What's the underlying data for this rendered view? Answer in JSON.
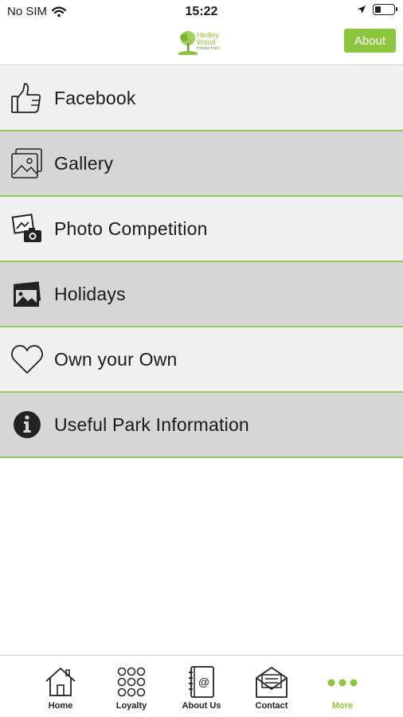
{
  "status_bar": {
    "carrier": "No SIM",
    "time": "15:22"
  },
  "header": {
    "logo_name": "Hedley Wood",
    "logo_sub": "Holiday Park",
    "about_label": "About",
    "accent_color": "#8cc63f"
  },
  "menu": {
    "items": [
      {
        "label": "Facebook",
        "icon": "thumbs-up-icon"
      },
      {
        "label": "Gallery",
        "icon": "picture-icon"
      },
      {
        "label": "Photo Competition",
        "icon": "photo-camera-icon"
      },
      {
        "label": "Holidays",
        "icon": "photos-icon"
      },
      {
        "label": "Own your Own",
        "icon": "heart-icon"
      },
      {
        "label": "Useful Park Information",
        "icon": "info-icon"
      }
    ]
  },
  "tab_bar": {
    "tabs": [
      {
        "label": "Home",
        "icon": "home-icon"
      },
      {
        "label": "Loyalty",
        "icon": "dots-grid-icon"
      },
      {
        "label": "About Us",
        "icon": "contact-book-icon"
      },
      {
        "label": "Contact",
        "icon": "envelope-icon"
      },
      {
        "label": "More",
        "icon": "more-dots-icon",
        "active": true
      }
    ]
  }
}
